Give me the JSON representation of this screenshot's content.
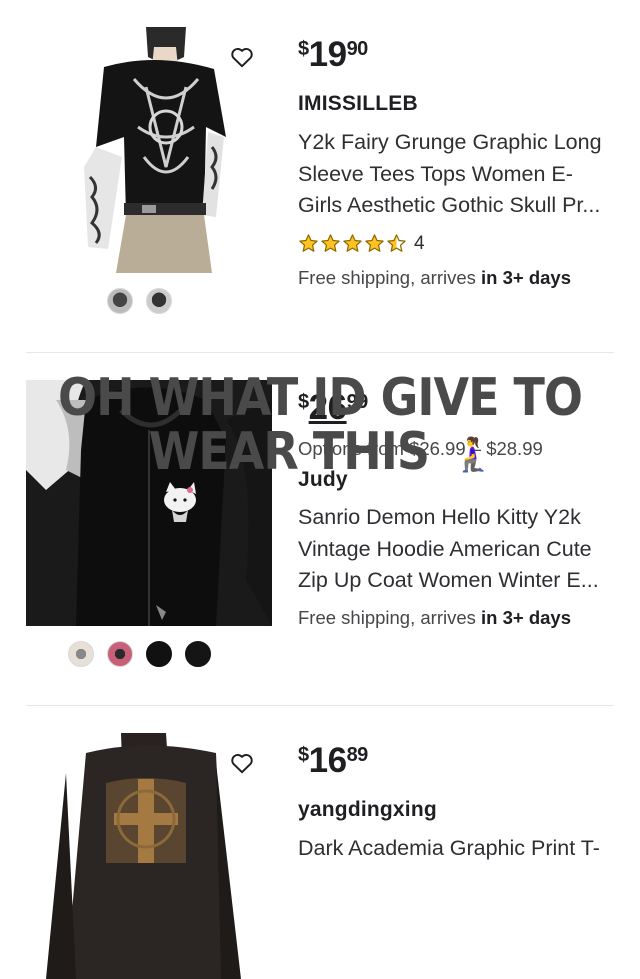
{
  "products": [
    {
      "price_currency": "$",
      "price_dollars": "19",
      "price_cents": "90",
      "seller": "IMISSILLEB",
      "title_lines": [
        "Y2k Fairy Grunge Graphic Long",
        "Sleeve Tees Tops Women E-",
        "Girls Aesthetic Gothic Skull Pr..."
      ],
      "rating_value": 4.5,
      "rating_count": "4",
      "shipping_prefix": "Free shipping, arrives ",
      "shipping_bold": "in 3+ days"
    },
    {
      "price_currency": "$",
      "price_dollars": "26",
      "price_cents": "99",
      "options_text": "Options from $26.99 – $28.99",
      "seller": "Judy",
      "title_lines": [
        "Sanrio Demon Hello Kitty Y2k",
        "Vintage Hoodie American Cute",
        "Zip Up Coat Women Winter E..."
      ],
      "shipping_prefix": "Free shipping, arrives ",
      "shipping_bold": "in 3+ days"
    },
    {
      "price_currency": "$",
      "price_dollars": "16",
      "price_cents": "89",
      "seller": "yangdingxing",
      "title_lines": [
        "Dark Academia Graphic Print T-"
      ]
    }
  ],
  "overlay": {
    "line1": "OH WHAT ID GIVE TO",
    "line2": "WEAR THIS",
    "emoji": "🧎‍♀️"
  },
  "colors": {
    "star": "#ffc220",
    "star_stroke": "#8a6a00",
    "swatches_p1": [
      "#2b2b2b",
      "#3a3a3a"
    ],
    "swatches_p2": [
      "#d9d2c8",
      "#c8607a",
      "#111111",
      "#151515"
    ]
  },
  "icons": {
    "heart": "heart-outline-icon",
    "star": "star-icon"
  }
}
